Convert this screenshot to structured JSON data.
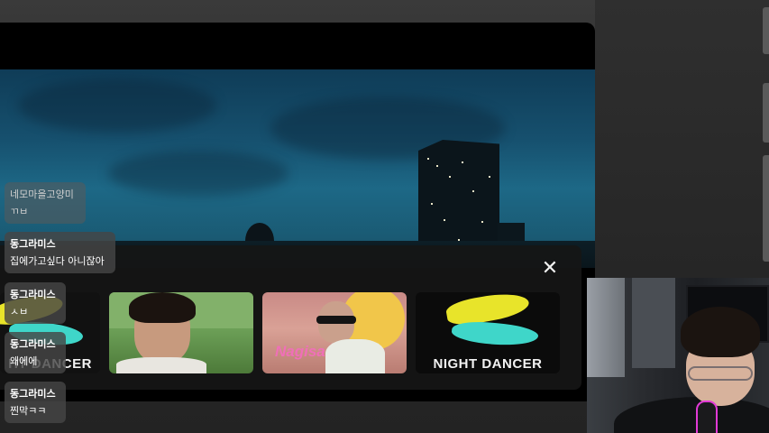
{
  "chat": {
    "messages": [
      {
        "nick": "네모마을고양미",
        "text": "ㄲㅂ",
        "faded": true
      },
      {
        "nick": "동그라미스",
        "text": "집에가고싶다 아니잖아",
        "faded": false
      },
      {
        "nick": "동그라미스",
        "text": "ㅅㅂ",
        "faded": false
      },
      {
        "nick": "동그라미스",
        "text": "왜에에",
        "faded": false
      },
      {
        "nick": "동그라미스",
        "text": "찐막ㅋㅋ",
        "faded": false
      }
    ]
  },
  "recommendations": {
    "close_icon": "close-icon",
    "items": [
      {
        "caption": "HT DANCER",
        "kind": "night-dancer-art"
      },
      {
        "caption": "",
        "kind": "music-video-outdoor"
      },
      {
        "caption": "Nagisa",
        "kind": "music-video-sunglasses"
      },
      {
        "caption": "NIGHT DANCER",
        "kind": "night-dancer-art"
      }
    ]
  },
  "colors": {
    "accent_yellow": "#e8e42a",
    "accent_cyan": "#3fd6c9",
    "nagisa_pink": "#f06fb8"
  }
}
